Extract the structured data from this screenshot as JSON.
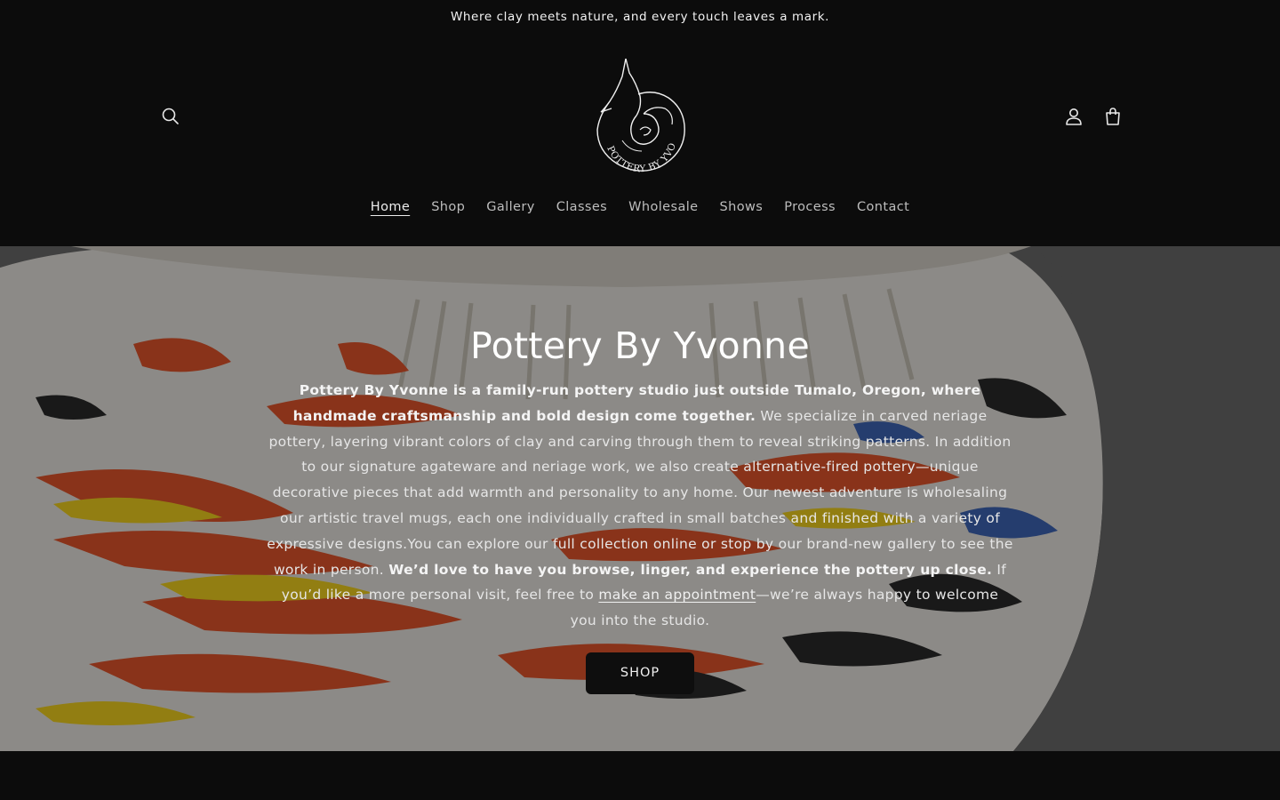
{
  "announcement": {
    "text": "Where clay meets nature, and every touch leaves a mark."
  },
  "header": {
    "logo_text": "POTTERY BY YVONNE",
    "search_icon": "search-icon",
    "account_icon": "user-icon",
    "cart_icon": "shopping-bag-icon"
  },
  "nav": {
    "items": [
      {
        "label": "Home",
        "active": true
      },
      {
        "label": "Shop"
      },
      {
        "label": "Gallery"
      },
      {
        "label": "Classes"
      },
      {
        "label": "Wholesale"
      },
      {
        "label": "Shows"
      },
      {
        "label": "Process"
      },
      {
        "label": "Contact"
      }
    ]
  },
  "hero": {
    "title": "Pottery By Yvonne",
    "p1_bold": "Pottery By Yvonne is a family-run pottery studio just outside Tumalo, Oregon, where handmade craftsmanship and bold design come together.",
    "p1_rest": " We specialize in carved neriage pottery, layering vibrant colors of clay and carving through them to reveal striking patterns. In addition to our signature agateware and neriage work, we also create alternative-fired pottery—unique decorative pieces that add warmth and personality to any home. Our newest adventure is wholesaling our artistic travel mugs, each one individually crafted in small batches and finished with a variety of expressive designs.You can explore our full collection online or stop by our brand-new gallery to see the work in person. ",
    "p2_bold": "We’d love to have you browse, linger, and experience the pottery up close.",
    "p2_rest": " If you’d like a more personal visit, feel free to ",
    "link_text": "make an appointment",
    "p3": "—we’re always happy to welcome you into the studio.",
    "button_label": "SHOP"
  },
  "colors": {
    "background": "#0c0c0c",
    "button_bg": "#0e0e0e",
    "nav_text": "#bdbdbd"
  }
}
